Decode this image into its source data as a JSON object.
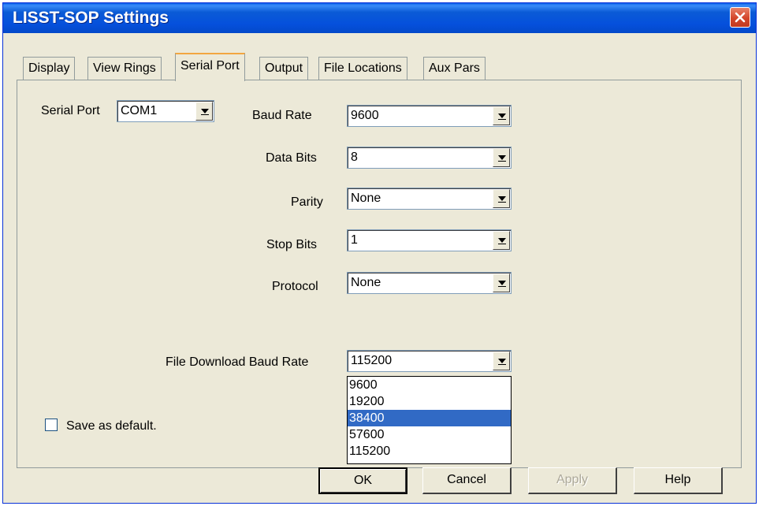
{
  "window": {
    "title": "LISST-SOP Settings"
  },
  "tabs": [
    {
      "label": "Display"
    },
    {
      "label": "View Rings"
    },
    {
      "label": "Serial Port"
    },
    {
      "label": "Output"
    },
    {
      "label": "File Locations"
    },
    {
      "label": "Aux Pars"
    }
  ],
  "active_tab": "Serial Port",
  "fields": {
    "serial_port": {
      "label": "Serial Port",
      "value": "COM1"
    },
    "baud_rate": {
      "label": "Baud Rate",
      "value": "9600"
    },
    "data_bits": {
      "label": "Data Bits",
      "value": "8"
    },
    "parity": {
      "label": "Parity",
      "value": "None"
    },
    "stop_bits": {
      "label": "Stop Bits",
      "value": "1"
    },
    "protocol": {
      "label": "Protocol",
      "value": "None"
    },
    "file_download_baud_rate": {
      "label": "File Download Baud Rate",
      "value": "115200"
    }
  },
  "dropdown": {
    "options": [
      "9600",
      "19200",
      "38400",
      "57600",
      "115200"
    ],
    "highlighted": "38400"
  },
  "save_default": {
    "label": "Save as default.",
    "checked": false
  },
  "buttons": {
    "ok": "OK",
    "cancel": "Cancel",
    "apply": "Apply",
    "help": "Help"
  },
  "colors": {
    "titlebar": "#0550dc",
    "highlight": "#316ac5",
    "close": "#d3452a"
  }
}
